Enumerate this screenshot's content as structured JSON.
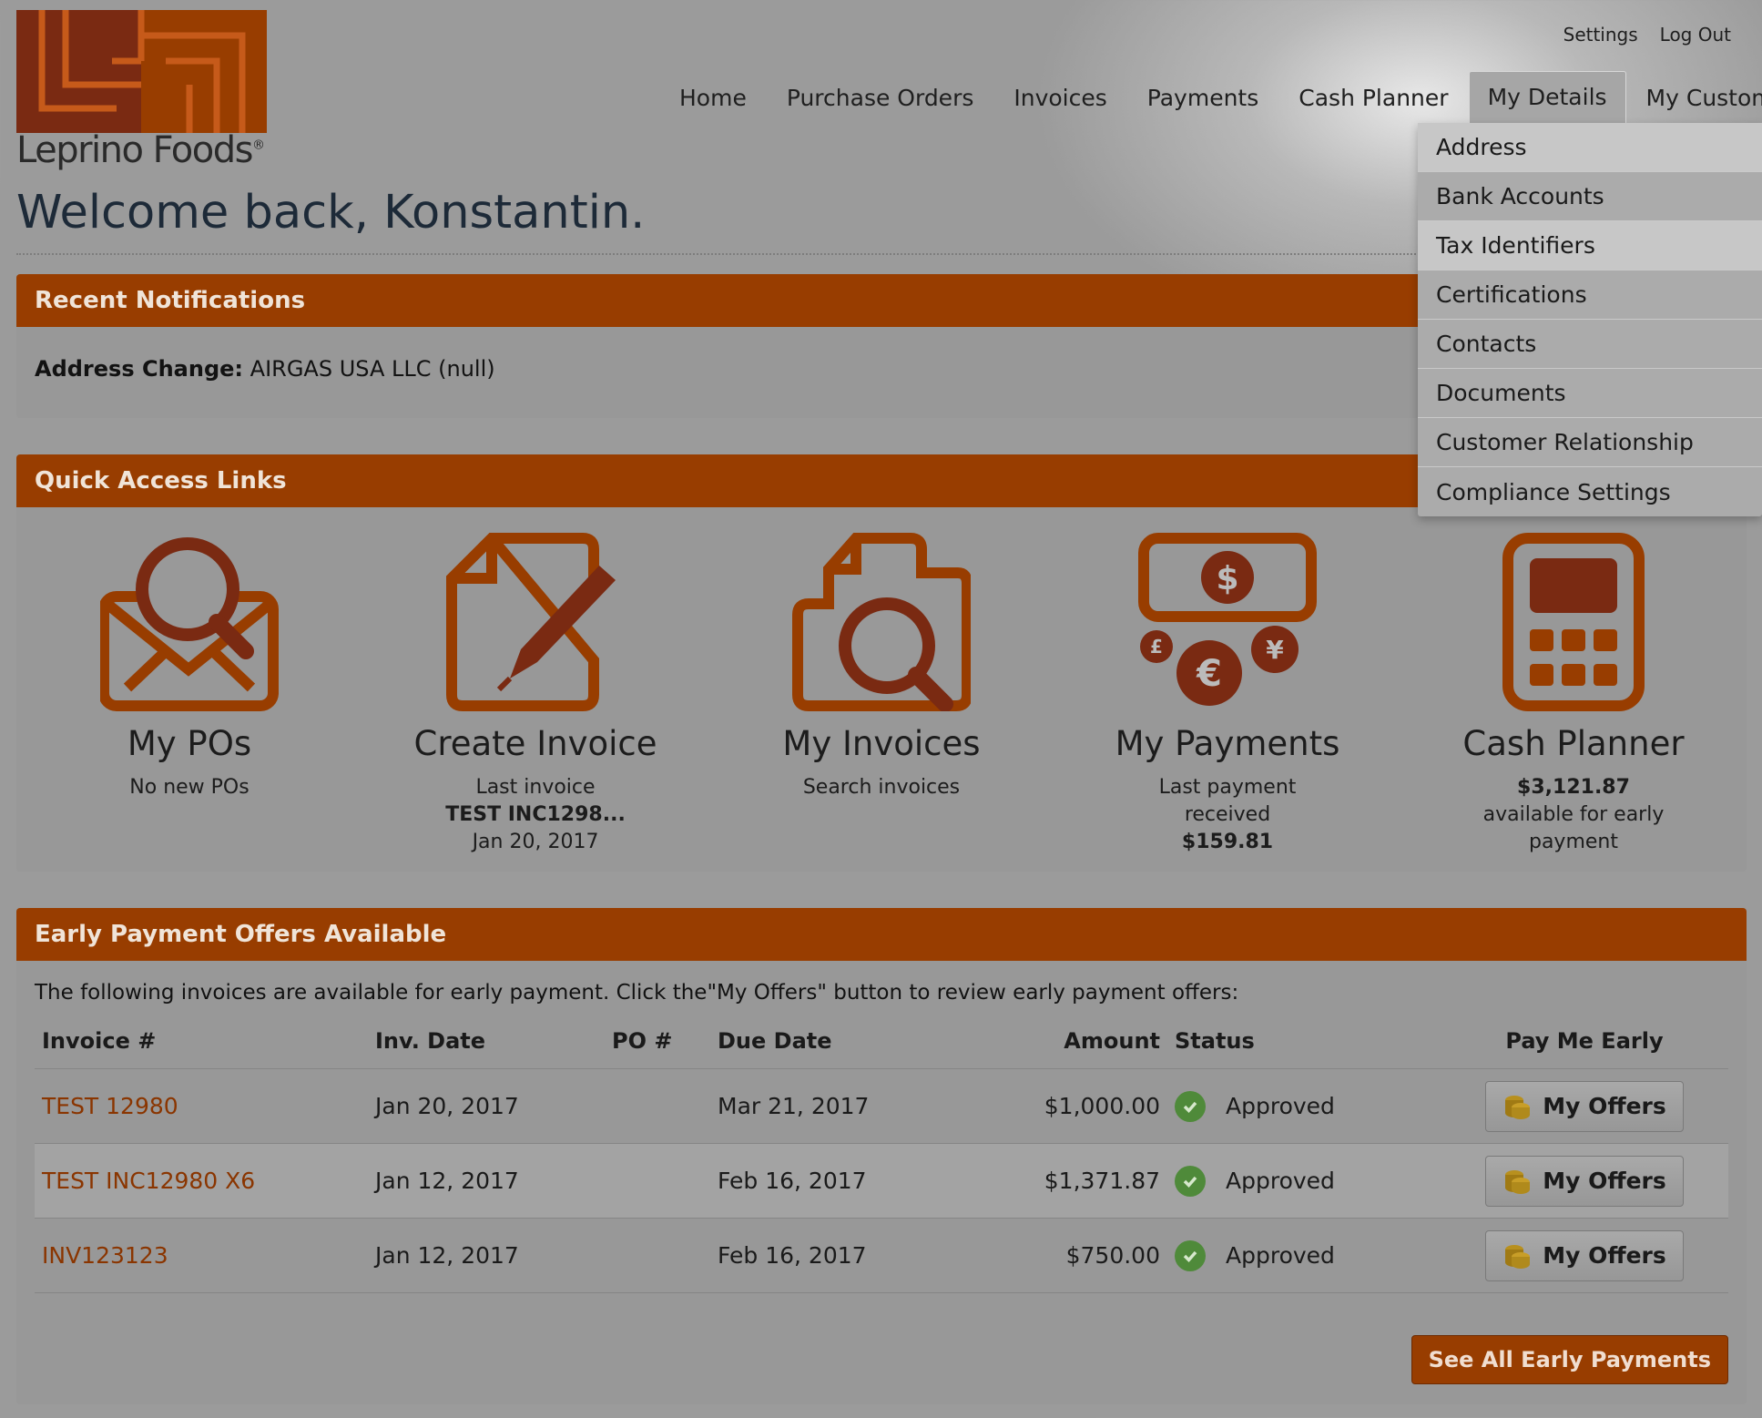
{
  "brand": {
    "logo_text": "Leprino Foods",
    "logo_mark": "®",
    "accent": "#983d00",
    "accent_dark": "#7a2a12"
  },
  "header": {
    "settings": "Settings",
    "logout": "Log Out"
  },
  "nav": {
    "items": [
      "Home",
      "Purchase Orders",
      "Invoices",
      "Payments",
      "Cash Planner",
      "My Details",
      "My Customer"
    ],
    "active": "My Details"
  },
  "dropdown": {
    "items": [
      "Address",
      "Bank Accounts",
      "Tax Identifiers",
      "Certifications",
      "Contacts",
      "Documents",
      "Customer Relationship",
      "Compliance Settings"
    ]
  },
  "welcome": "Welcome back, Konstantin.",
  "notifications": {
    "title": "Recent Notifications",
    "label": "Address Change:",
    "text": "AIRGAS USA LLC (null)"
  },
  "quick": {
    "title": "Quick Access Links",
    "items": [
      {
        "icon": "po-search-icon",
        "title": "My POs",
        "line1": "No new POs",
        "line2": "",
        "line3": ""
      },
      {
        "icon": "create-invoice-icon",
        "title": "Create Invoice",
        "line1": "Last invoice",
        "line2": "TEST INC1298...",
        "line3": "Jan 20, 2017"
      },
      {
        "icon": "search-invoices-icon",
        "title": "My Invoices",
        "line1": "Search invoices",
        "line2": "",
        "line3": ""
      },
      {
        "icon": "payments-icon",
        "title": "My Payments",
        "line1": "Last payment",
        "line2": "received",
        "line3": "$159.81"
      },
      {
        "icon": "calculator-icon",
        "title": "Cash Planner",
        "line1": "$3,121.87",
        "line2": "available for early",
        "line3": "payment"
      }
    ]
  },
  "offers": {
    "title": "Early Payment Offers Available",
    "intro": "The following invoices are available for early payment. Click the\"My Offers\" button to review early payment offers:",
    "columns": {
      "invoice": "Invoice #",
      "date": "Inv. Date",
      "po": "PO #",
      "due": "Due Date",
      "amount": "Amount",
      "status": "Status",
      "pay": "Pay Me Early"
    },
    "rows": [
      {
        "invoice": "TEST 12980",
        "date": "Jan 20, 2017",
        "po": "",
        "due": "Mar 21, 2017",
        "amount": "$1,000.00",
        "status": "Approved",
        "button": "My Offers"
      },
      {
        "invoice": "TEST INC12980 X6",
        "date": "Jan 12, 2017",
        "po": "",
        "due": "Feb 16, 2017",
        "amount": "$1,371.87",
        "status": "Approved",
        "button": "My Offers"
      },
      {
        "invoice": "INV123123",
        "date": "Jan 12, 2017",
        "po": "",
        "due": "Feb 16, 2017",
        "amount": "$750.00",
        "status": "Approved",
        "button": "My Offers"
      }
    ],
    "see_all": "See All Early Payments"
  }
}
